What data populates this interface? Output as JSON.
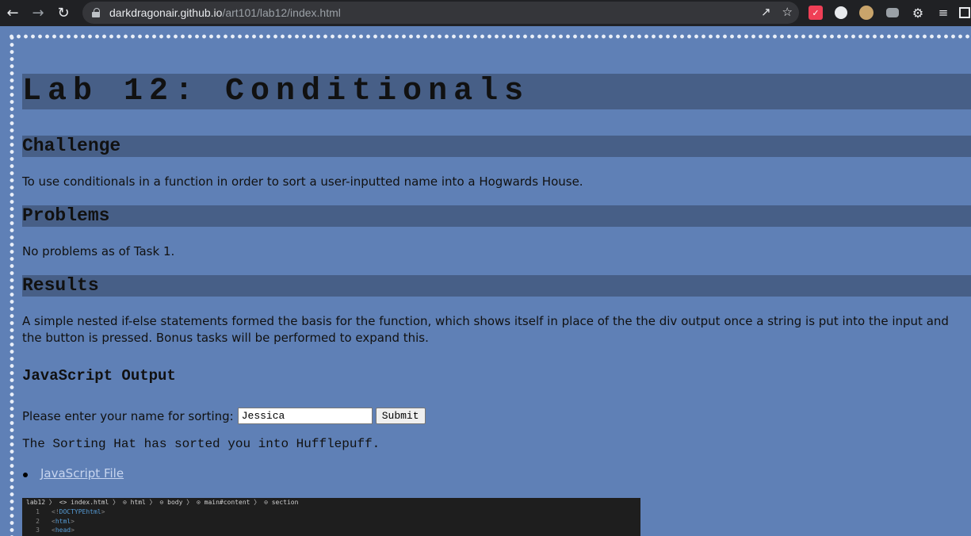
{
  "browser": {
    "url_host": "darkdragonair.github.io",
    "url_path": "/art101/lab12/index.html",
    "icons": [
      "back-arrow-icon",
      "forward-arrow-icon",
      "reload-icon",
      "lock-icon",
      "share-icon",
      "star-icon",
      "pocket-icon",
      "chat-icon",
      "owl-icon",
      "camera-icon",
      "puzzle-icon",
      "reading-list-icon",
      "side-panel-icon"
    ]
  },
  "page": {
    "title": "Lab 12: Conditionals",
    "sections": {
      "challenge": {
        "heading": "Challenge",
        "text": "To use conditionals in a function in order to sort a user-inputted name into a Hogwards House."
      },
      "problems": {
        "heading": "Problems",
        "text": "No problems as of Task 1."
      },
      "results": {
        "heading": "Results",
        "text": "A simple nested if-else statements formed the basis for the function, which shows itself in place of the the div output once a string is put into the input and the button is pressed. Bonus tasks will be performed to expand this."
      }
    },
    "js_output": {
      "heading": "JavaScript Output",
      "prompt_label": "Please enter your name for sorting:",
      "input_value": "Jessica",
      "submit_label": "Submit",
      "result": "The Sorting Hat has sorted you into Hufflepuff."
    },
    "links": [
      {
        "label": "JavaScript File"
      }
    ],
    "code_snippet": {
      "breadcrumbs": "lab12 〉 <> index.html 〉 ⊙ html 〉 ⊙ body 〉 ⊙ main#content 〉 ⊙ section",
      "lines": [
        {
          "num": "1",
          "open": "<!",
          "tag": "DOCTYPE",
          "kw": " html",
          "close": ">"
        },
        {
          "num": "2",
          "open": "<",
          "tag": "html",
          "kw": "",
          "close": ">"
        },
        {
          "num": "3",
          "open": "<",
          "tag": "head",
          "kw": "",
          "close": ">"
        }
      ]
    }
  },
  "colors": {
    "page_bg": "#5f80b6",
    "heading_bar": "#475f87",
    "link": "#c7d5ef",
    "chrome_bg": "#202124"
  }
}
